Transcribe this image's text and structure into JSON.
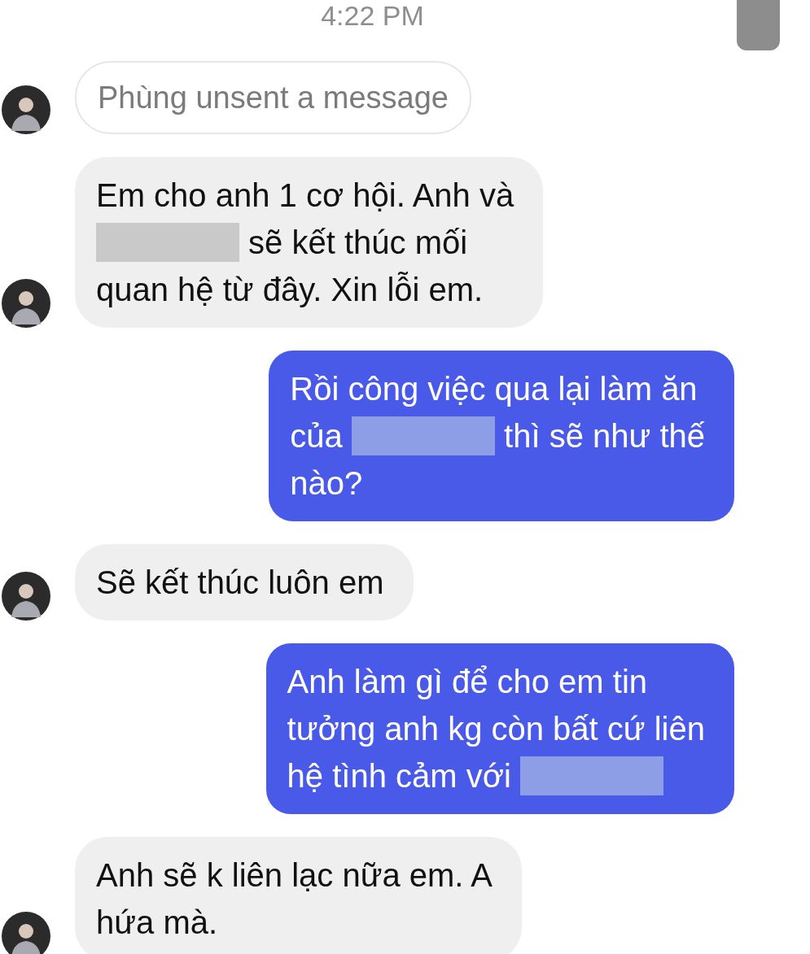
{
  "timestamp": "4:22 PM",
  "messages": [
    {
      "kind": "unsent",
      "parts": [
        {
          "kind": "text",
          "text": "Phùng unsent a message"
        }
      ]
    },
    {
      "kind": "incoming",
      "parts": [
        {
          "kind": "text",
          "text": "Em cho anh 1 cơ hội. Anh và"
        },
        {
          "kind": "break"
        },
        {
          "kind": "redaction"
        },
        {
          "kind": "text",
          "text": " sẽ kết thúc mối"
        },
        {
          "kind": "break"
        },
        {
          "kind": "text",
          "text": "quan hệ từ đây. Xin lỗi em."
        }
      ]
    },
    {
      "kind": "outgoing",
      "parts": [
        {
          "kind": "text",
          "text": "Rồi công việc qua lại làm ăn"
        },
        {
          "kind": "break"
        },
        {
          "kind": "text",
          "text": "của "
        },
        {
          "kind": "redaction"
        },
        {
          "kind": "text",
          "text": " thì sẽ như thế"
        },
        {
          "kind": "break"
        },
        {
          "kind": "text",
          "text": "nào?"
        }
      ]
    },
    {
      "kind": "incoming",
      "parts": [
        {
          "kind": "text",
          "text": "Sẽ kết thúc luôn em"
        }
      ]
    },
    {
      "kind": "outgoing",
      "parts": [
        {
          "kind": "text",
          "text": "Anh làm gì để cho em tin"
        },
        {
          "kind": "break"
        },
        {
          "kind": "text",
          "text": "tưởng anh kg còn bất cứ liên"
        },
        {
          "kind": "break"
        },
        {
          "kind": "text",
          "text": "hệ tình cảm với "
        },
        {
          "kind": "redaction"
        }
      ]
    },
    {
      "kind": "incoming",
      "parts": [
        {
          "kind": "text",
          "text": "Anh sẽ k liên lạc nữa em. A"
        },
        {
          "kind": "break"
        },
        {
          "kind": "text",
          "text": "hứa mà."
        }
      ]
    }
  ]
}
